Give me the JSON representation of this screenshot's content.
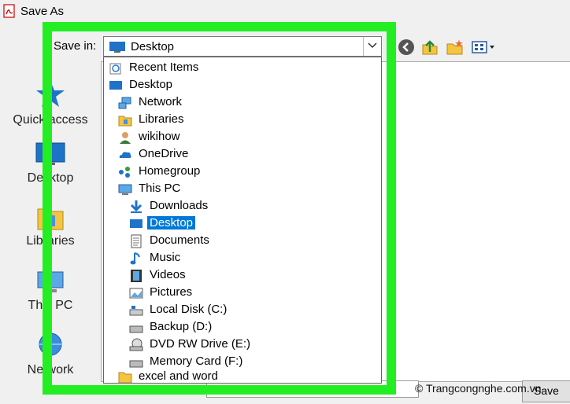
{
  "window": {
    "title": "Save As"
  },
  "save_in": {
    "label": "Save in:",
    "value": "Desktop"
  },
  "places": [
    {
      "label": "Quick access",
      "icon": "star-icon"
    },
    {
      "label": "Desktop",
      "icon": "desktop-icon"
    },
    {
      "label": "Libraries",
      "icon": "libraries-icon"
    },
    {
      "label": "This PC",
      "icon": "computer-icon"
    },
    {
      "label": "Network",
      "icon": "network-icon"
    }
  ],
  "dropdown": {
    "items": [
      {
        "label": "Recent Items",
        "icon": "recent-items-icon",
        "level": 0,
        "selected": false
      },
      {
        "label": "Desktop",
        "icon": "desktop-icon",
        "level": 0,
        "selected": false
      },
      {
        "label": "Network",
        "icon": "network-icon",
        "level": 1,
        "selected": false
      },
      {
        "label": "Libraries",
        "icon": "libraries-icon",
        "level": 1,
        "selected": false
      },
      {
        "label": "wikihow",
        "icon": "user-icon",
        "level": 1,
        "selected": false
      },
      {
        "label": "OneDrive",
        "icon": "onedrive-icon",
        "level": 1,
        "selected": false
      },
      {
        "label": "Homegroup",
        "icon": "homegroup-icon",
        "level": 1,
        "selected": false
      },
      {
        "label": "This PC",
        "icon": "computer-icon",
        "level": 1,
        "selected": false
      },
      {
        "label": "Downloads",
        "icon": "downloads-icon",
        "level": 2,
        "selected": false
      },
      {
        "label": "Desktop",
        "icon": "desktop-icon",
        "level": 2,
        "selected": true
      },
      {
        "label": "Documents",
        "icon": "documents-icon",
        "level": 2,
        "selected": false
      },
      {
        "label": "Music",
        "icon": "music-icon",
        "level": 2,
        "selected": false
      },
      {
        "label": "Videos",
        "icon": "videos-icon",
        "level": 2,
        "selected": false
      },
      {
        "label": "Pictures",
        "icon": "pictures-icon",
        "level": 2,
        "selected": false
      },
      {
        "label": "Local Disk (C:)",
        "icon": "local-disk-icon",
        "level": 2,
        "selected": false
      },
      {
        "label": "Backup (D:)",
        "icon": "drive-icon",
        "level": 2,
        "selected": false
      },
      {
        "label": "DVD RW Drive (E:)",
        "icon": "dvd-drive-icon",
        "level": 2,
        "selected": false
      },
      {
        "label": "Memory Card (F:)",
        "icon": "drive-icon",
        "level": 2,
        "selected": false
      },
      {
        "label": "excel and word",
        "icon": "folder-icon",
        "level": 1,
        "selected": false
      }
    ]
  },
  "toolbar": {
    "back_icon": "back-icon",
    "up_icon": "up-folder-icon",
    "new_folder_icon": "new-folder-icon",
    "view_icon": "view-menu-icon"
  },
  "footer": {
    "filename_value": "",
    "save_label": "Save"
  },
  "watermark": "© Trangcongnghe.com.vn",
  "colors": {
    "highlight_frame": "#22ee22",
    "selection": "#0078d7"
  }
}
